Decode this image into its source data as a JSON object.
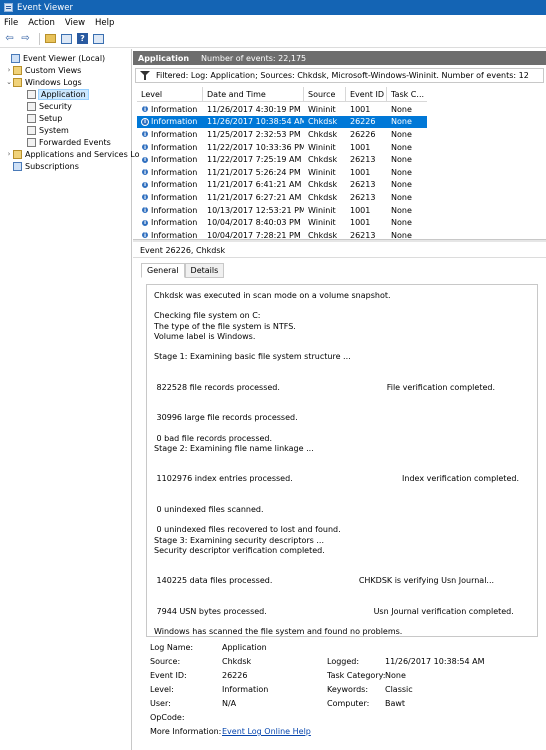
{
  "window": {
    "title": "Event Viewer"
  },
  "menu": [
    "File",
    "Action",
    "View",
    "Help"
  ],
  "tree": {
    "items": [
      {
        "label": "Event Viewer (Local)",
        "icon": "computer-icon",
        "chevron": ""
      },
      {
        "label": "Custom Views",
        "icon": "folder-icon",
        "chevron": "›"
      },
      {
        "label": "Windows Logs",
        "icon": "folder-icon",
        "chevron": "⌄"
      },
      {
        "label": "Application",
        "icon": "log-icon",
        "chevron": ""
      },
      {
        "label": "Security",
        "icon": "log-icon",
        "chevron": ""
      },
      {
        "label": "Setup",
        "icon": "log-icon",
        "chevron": ""
      },
      {
        "label": "System",
        "icon": "log-icon",
        "chevron": ""
      },
      {
        "label": "Forwarded Events",
        "icon": "log-icon",
        "chevron": ""
      },
      {
        "label": "Applications and Services Lo",
        "icon": "folder-icon",
        "chevron": "›"
      },
      {
        "label": "Subscriptions",
        "icon": "subscription-icon",
        "chevron": ""
      }
    ]
  },
  "panel": {
    "title": "Application",
    "count_text": "Number of events: 22,175",
    "filter_text": "Filtered: Log: Application; Sources: Chkdsk, Microsoft-Windows-Wininit. Number of events: 12"
  },
  "table": {
    "columns": [
      "Level",
      "Date and Time",
      "Source",
      "Event ID",
      "Task C..."
    ],
    "rows": [
      [
        "Information",
        "11/26/2017 4:30:19 PM",
        "Wininit",
        "1001",
        "None"
      ],
      [
        "Information",
        "11/26/2017 10:38:54 AM",
        "Chkdsk",
        "26226",
        "None"
      ],
      [
        "Information",
        "11/25/2017 2:32:53 PM",
        "Chkdsk",
        "26226",
        "None"
      ],
      [
        "Information",
        "11/22/2017 10:33:36 PM",
        "Wininit",
        "1001",
        "None"
      ],
      [
        "Information",
        "11/22/2017 7:25:19 AM",
        "Chkdsk",
        "26213",
        "None"
      ],
      [
        "Information",
        "11/21/2017 5:26:24 PM",
        "Wininit",
        "1001",
        "None"
      ],
      [
        "Information",
        "11/21/2017 6:41:21 AM",
        "Chkdsk",
        "26213",
        "None"
      ],
      [
        "Information",
        "11/21/2017 6:27:21 AM",
        "Chkdsk",
        "26213",
        "None"
      ],
      [
        "Information",
        "10/13/2017 12:53:21 PM",
        "Wininit",
        "1001",
        "None"
      ],
      [
        "Information",
        "10/04/2017 8:40:03 PM",
        "Wininit",
        "1001",
        "None"
      ],
      [
        "Information",
        "10/04/2017 7:28:21 PM",
        "Chkdsk",
        "26213",
        "None"
      ]
    ],
    "selected_index": 1
  },
  "detail": {
    "title": "Event 26226, Chkdsk",
    "tabs": [
      "General",
      "Details"
    ],
    "description_lines": [
      "Chkdsk was executed in scan mode on a volume snapshot.",
      "",
      "Checking file system on C:",
      "The type of the file system is NTFS.",
      "Volume label is Windows.",
      "",
      "Stage 1: Examining basic file system structure ...",
      "",
      "",
      " 822528 file records processed.                                          File verification completed.",
      "",
      "",
      " 30996 large file records processed.",
      "",
      " 0 bad file records processed.",
      "Stage 2: Examining file name linkage ...",
      "",
      "",
      " 1102976 index entries processed.                                           Index verification completed.",
      "",
      "",
      " 0 unindexed files scanned.",
      "",
      " 0 unindexed files recovered to lost and found.",
      "Stage 3: Examining security descriptors ...",
      "Security descriptor verification completed.",
      "",
      "",
      " 140225 data files processed.                                  CHKDSK is verifying Usn Journal...",
      "",
      "",
      " 7944 USN bytes processed.                                          Usn Journal verification completed.",
      "",
      "Windows has scanned the file system and found no problems."
    ],
    "props": {
      "log_name_label": "Log Name:",
      "log_name": "Application",
      "source_label": "Source:",
      "source": "Chkdsk",
      "logged_label": "Logged:",
      "logged": "11/26/2017 10:38:54 AM",
      "event_id_label": "Event ID:",
      "event_id": "26226",
      "task_category_label": "Task Category:",
      "task_category": "None",
      "level_label": "Level:",
      "level": "Information",
      "keywords_label": "Keywords:",
      "keywords": "Classic",
      "user_label": "User:",
      "user": "N/A",
      "computer_label": "Computer:",
      "computer": "Bawt",
      "opcode_label": "OpCode:",
      "more_info_label": "More Information:",
      "more_info_link": "Event Log Online Help"
    }
  },
  "colors": {
    "titlebar": "#1464b4",
    "selection": "#0078d7",
    "header": "#6d6d6d"
  }
}
